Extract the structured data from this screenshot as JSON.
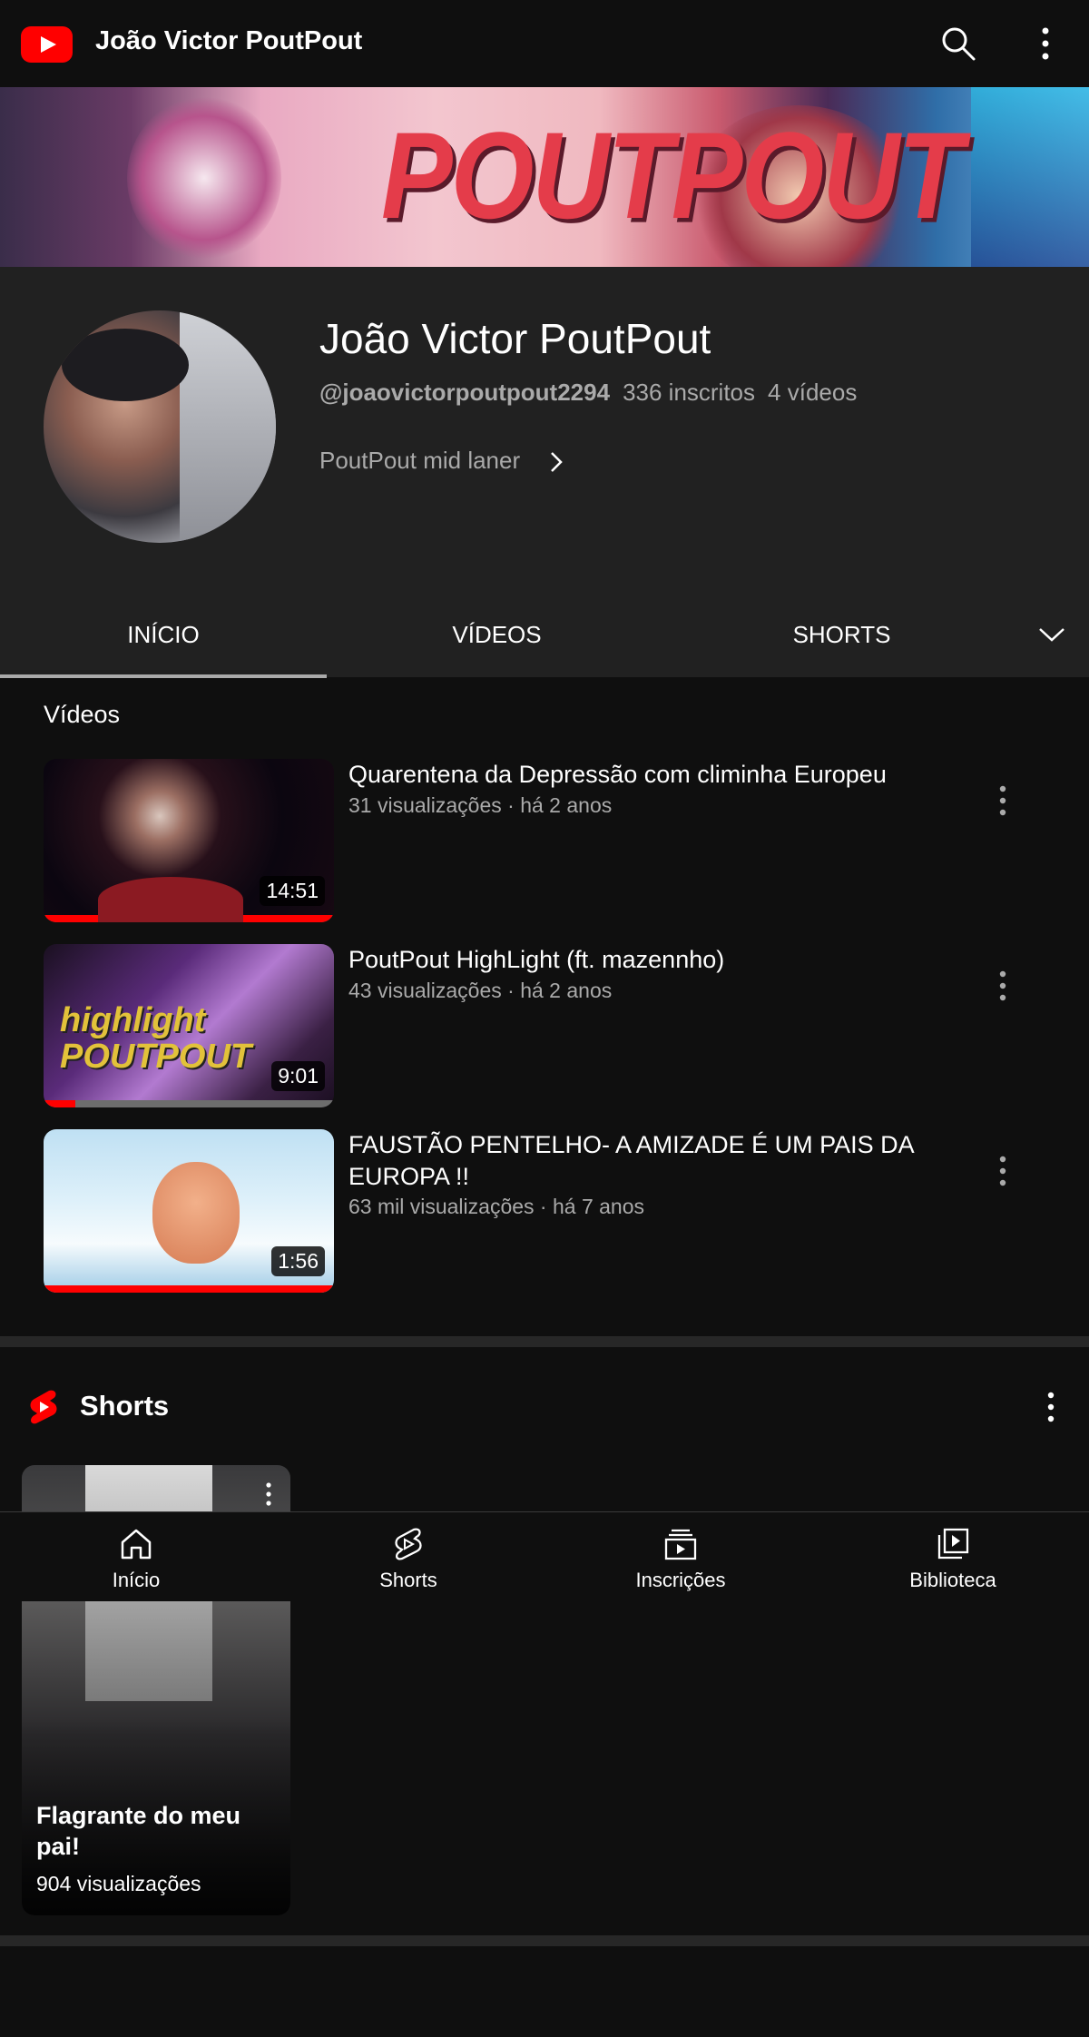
{
  "header": {
    "title": "João Victor PoutPout",
    "icons": [
      "youtube-logo",
      "search-icon",
      "more-vertical-icon"
    ]
  },
  "banner": {
    "text": "POUTPOUT"
  },
  "channel": {
    "name": "João Victor PoutPout",
    "handle": "@joaovictorpoutpout2294",
    "subscribers": "336 inscritos",
    "videos_count": "4 vídeos",
    "description": "PoutPout mid laner"
  },
  "tabs": [
    {
      "label": "INÍCIO",
      "selected": true
    },
    {
      "label": "VÍDEOS",
      "selected": false
    },
    {
      "label": "SHORTS",
      "selected": false
    }
  ],
  "videos_section": {
    "title": "Vídeos",
    "items": [
      {
        "title": "Quarentena da Depressão com climinha Europeu",
        "meta": "31 visualizações · há 2 anos",
        "duration": "14:51",
        "watched_fraction": 1.0
      },
      {
        "title": "PoutPout HighLight (ft. mazennho)",
        "meta": "43 visualizações · há 2 anos",
        "duration": "9:01",
        "watched_fraction": 0.11,
        "thumbnail_text": "highlight POUTPOUT"
      },
      {
        "title": "FAUSTÃO PENTELHO- A AMIZADE É UM PAIS DA EUROPA !!",
        "meta": "63 mil visualizações · há 7 anos",
        "duration": "1:56",
        "watched_fraction": 1.0
      }
    ]
  },
  "shorts_section": {
    "title": "Shorts",
    "items": [
      {
        "title": "Flagrante do meu pai!",
        "views": "904 visualizações"
      }
    ]
  },
  "bottom_nav": [
    {
      "label": "Início",
      "icon": "home-icon"
    },
    {
      "label": "Shorts",
      "icon": "shorts-icon"
    },
    {
      "label": "Inscrições",
      "icon": "subscriptions-icon"
    },
    {
      "label": "Biblioteca",
      "icon": "library-icon"
    }
  ],
  "colors": {
    "accent": "#ff0000",
    "background": "#0f0f0f",
    "header_bg": "#212121",
    "secondary_text": "#aaaaaa"
  }
}
